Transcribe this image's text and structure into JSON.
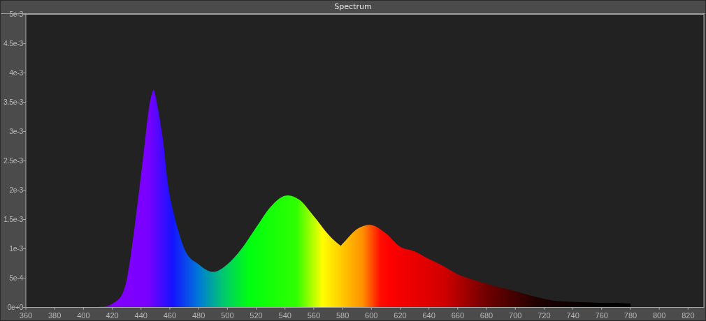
{
  "chart": {
    "chart_data": {
      "type": "area",
      "title": "Spectrum",
      "x": [
        400,
        410,
        420,
        430,
        440,
        445,
        448,
        450,
        455,
        460,
        470,
        480,
        490,
        500,
        510,
        520,
        530,
        540,
        550,
        560,
        570,
        578,
        580,
        590,
        600,
        610,
        620,
        630,
        640,
        650,
        660,
        670,
        680,
        690,
        700,
        710,
        720,
        730,
        740,
        750,
        760,
        770,
        780
      ],
      "series": [
        {
          "values": [
            0,
            0,
            5e-05,
            0.00046,
            0.00225,
            0.0033,
            0.00367,
            0.0036,
            0.0029,
            0.0019,
            0.001,
            0.00073,
            0.0006,
            0.00073,
            0.001,
            0.00136,
            0.00171,
            0.0019,
            0.00183,
            0.00155,
            0.00124,
            0.00106,
            0.00108,
            0.00133,
            0.0014,
            0.00126,
            0.00103,
            0.00095,
            0.00082,
            0.0007,
            0.00056,
            0.00047,
            0.0004,
            0.00033,
            0.00027,
            0.0002,
            0.00014,
            0.0001,
            9e-05,
            8e-05,
            7e-05,
            7e-05,
            6e-05
          ]
        }
      ],
      "xlim": [
        360,
        831
      ],
      "ylim": [
        0,
        0.005
      ],
      "xticks": [
        360,
        380,
        400,
        420,
        440,
        460,
        480,
        500,
        520,
        540,
        560,
        580,
        600,
        620,
        640,
        660,
        680,
        700,
        720,
        740,
        760,
        780,
        800,
        820
      ],
      "yticks": [
        {
          "value": 0,
          "label": "0e+0"
        },
        {
          "value": 0.0005,
          "label": "5e-4"
        },
        {
          "value": 0.001,
          "label": "1e-3"
        },
        {
          "value": 0.0015,
          "label": "1.5e-3"
        },
        {
          "value": 0.002,
          "label": "2e-3"
        },
        {
          "value": 0.0025,
          "label": "2.5e-3"
        },
        {
          "value": 0.003,
          "label": "3e-3"
        },
        {
          "value": 0.0035,
          "label": "3.5e-3"
        },
        {
          "value": 0.004,
          "label": "4e-3"
        },
        {
          "value": 0.0045,
          "label": "4.5e-3"
        },
        {
          "value": 0.005,
          "label": "5e-3"
        }
      ]
    }
  }
}
